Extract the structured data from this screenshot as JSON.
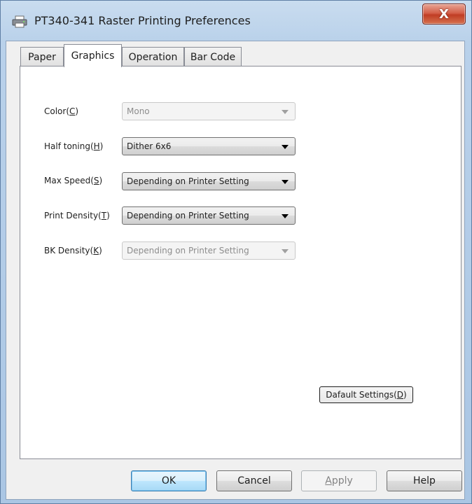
{
  "window": {
    "title": "PT340-341 Raster Printing Preferences",
    "close_glyph": "X",
    "icon": "printer-icon"
  },
  "tabs": [
    {
      "label": "Paper",
      "active": false
    },
    {
      "label": "Graphics",
      "active": true
    },
    {
      "label": "Operation",
      "active": false
    },
    {
      "label": "Bar Code",
      "active": false
    }
  ],
  "graphics": {
    "color": {
      "label": "Color(",
      "mnemonic": "C",
      "label_end": ")",
      "value": "Mono",
      "enabled": false
    },
    "half_toning": {
      "label": "Half toning(",
      "mnemonic": "H",
      "label_end": ")",
      "value": "Dither 6x6",
      "enabled": true
    },
    "max_speed": {
      "label": "Max Speed(",
      "mnemonic": "S",
      "label_end": ")",
      "value": "Depending on Printer Setting",
      "enabled": true
    },
    "print_density": {
      "label": "Print Density(",
      "mnemonic": "T",
      "label_end": ")",
      "value": "Depending on Printer Setting",
      "enabled": true
    },
    "bk_density": {
      "label": "BK Density(",
      "mnemonic": "K",
      "label_end": ")",
      "value": "Depending on Printer Setting",
      "enabled": false
    },
    "default_settings": {
      "label": "Dafault Settings(",
      "mnemonic": "D",
      "label_end": ")"
    }
  },
  "footer": {
    "ok": "OK",
    "cancel": "Cancel",
    "apply_mnemonic": "A",
    "apply_rest": "pply",
    "help": "Help"
  },
  "colors": {
    "title_bar": "#b9d1ea",
    "close_button": "#c03d24",
    "default_button_border": "#3c7fb1"
  }
}
